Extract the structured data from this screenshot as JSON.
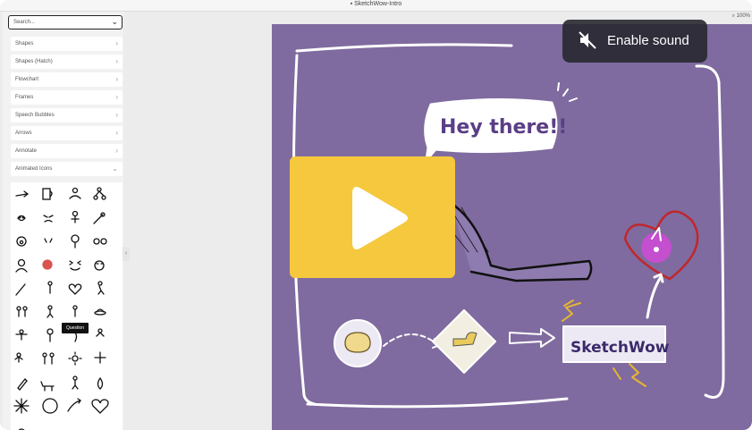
{
  "window": {
    "title": "SketchWow-Intro"
  },
  "sidebar": {
    "search_placeholder": "Search...",
    "categories": [
      {
        "label": "Shapes"
      },
      {
        "label": "Shapes (Hatch)"
      },
      {
        "label": "Flowchart"
      },
      {
        "label": "Frames"
      },
      {
        "label": "Speech Bubbles"
      },
      {
        "label": "Arrows"
      },
      {
        "label": "Annotate"
      },
      {
        "label": "Animated Icons"
      }
    ],
    "tooltip": "Question"
  },
  "toolbar": {
    "zoom": "100%"
  },
  "video": {
    "sound_label": "Enable sound",
    "bubble_text": "Hey there!!",
    "logo_text": "SketchWow"
  },
  "colors": {
    "canvas_bg": "#7f6b9f",
    "play_button": "#f5c83e",
    "sound_button": "#28282f"
  },
  "icons": [
    "search-icon",
    "chevron-down-icon",
    "chevron-right-icon",
    "mute-icon",
    "play-icon",
    "zoom-icon"
  ]
}
